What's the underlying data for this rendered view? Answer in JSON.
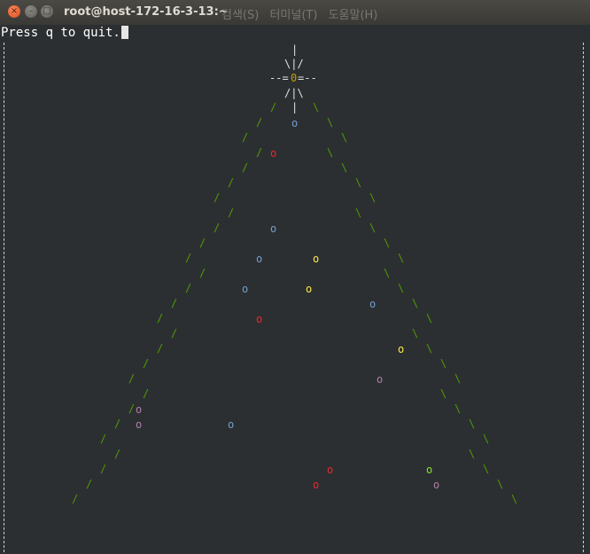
{
  "window": {
    "title": "root@host-172-16-3-13:~",
    "close": "×",
    "minimize": "–",
    "maximize": "□"
  },
  "menu": [
    "검색(S)",
    "터미널(T)",
    "도움말(H)"
  ],
  "terminal": {
    "status_text": "Press q to quit.",
    "star": {
      "top": "|",
      "upper": "\\|/",
      "middle_left": "--=",
      "core": "0",
      "middle_right": "=--",
      "lower": "/|\\",
      "stem": "|"
    },
    "branch_left": "/",
    "branch_right": "\\",
    "ornament": "o",
    "ornament_colors": {
      "blue": "#729fcf",
      "red": "#ef2929",
      "yellow": "#fce94f",
      "purple": "#ad7fa8",
      "green": "#8ae234"
    }
  }
}
